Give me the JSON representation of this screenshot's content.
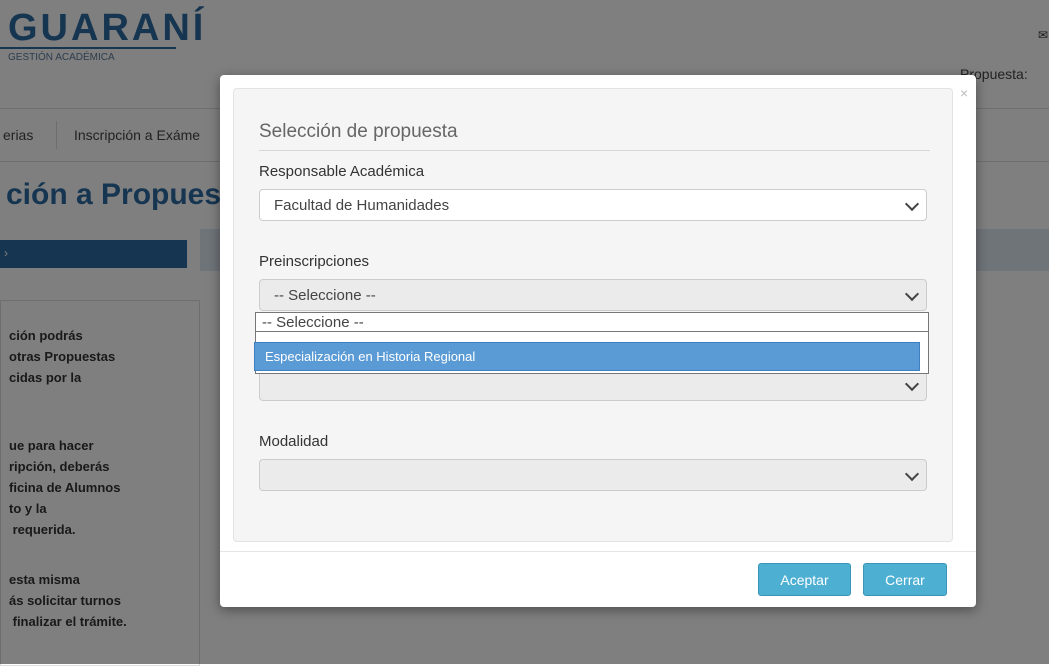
{
  "header": {
    "logo_title": "GUARANÍ",
    "logo_subtitle": "GESTIÓN ACADÉMICA",
    "mail_icon": "✉",
    "propuesta_label": "Propuesta:"
  },
  "nav": {
    "items": [
      "erias",
      "Inscripción a Exáme"
    ]
  },
  "page": {
    "heading": "ción a Propues",
    "bar_arrow": "›",
    "side_paragraphs": [
      "ción podrás\notras Propuestas\ncidas por la",
      "ue para hacer\nripción, deberás\nficina de Alumnos\nto y la\n requerida.",
      "esta misma\nás solicitar turnos\n finalizar el trámite."
    ]
  },
  "modal": {
    "close_icon": "×",
    "title": "Selección de propuesta",
    "responsable_label": "Responsable Académica",
    "responsable_value": "Facultad de Humanidades",
    "preinscripciones_label": "Preinscripciones",
    "preinscripciones_value": "-- Seleccione --",
    "dropdown_options": [
      "-- Seleccione --",
      "Especialización en Historia Regional"
    ],
    "hidden_select_value": "",
    "modalidad_label": "Modalidad",
    "modalidad_value": "",
    "accept_label": "Aceptar",
    "close_label": "Cerrar"
  },
  "colors": {
    "brand": "#2d6aa3",
    "button": "#4db0d3",
    "option_highlight": "#5b9bd5"
  }
}
